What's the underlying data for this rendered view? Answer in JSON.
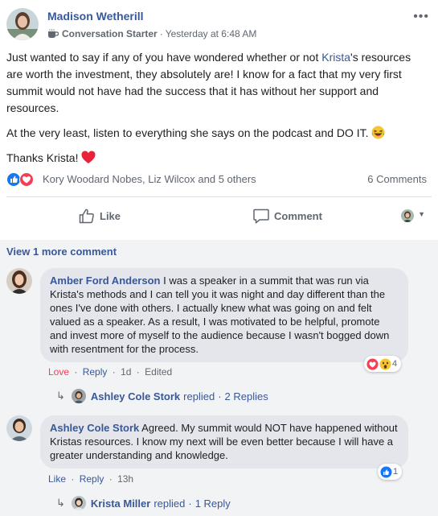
{
  "post": {
    "author": "Madison Wetherill",
    "badge": "Conversation Starter",
    "separator": "·",
    "timestamp": "Yesterday at 6:48 AM",
    "more_icon": "•••",
    "body_pre": "Just wanted to say if any of you have wondered whether or not ",
    "body_link": "Krista",
    "body_post": "'s resources are worth the investment, they absolutely are! I know for a fact that my very first summit would not have had the success that it has without her support and resources.",
    "body_p2": "At the very least, listen to everything she says on the podcast and DO IT.",
    "body_p3": "Thanks Krista!",
    "reactions_names": "Kory Woodard Nobes, Liz Wilcox and 5 others",
    "comment_count": "6 Comments",
    "like_label": "Like",
    "comment_label": "Comment",
    "caret": "▼"
  },
  "comments": {
    "view_more": "View 1 more comment",
    "items": [
      {
        "name": "Amber Ford Anderson",
        "text": "I was a speaker in a summit that was run via Krista's methods and I can tell you it was night and day different than the ones I've done with others. I actually knew what was going on and felt valued as a speaker. As a result, I was motivated to be helpful, promote and invest more of myself to the audience because I wasn't bogged down with resentment for the process.",
        "love": "Love",
        "reply": "Reply",
        "time": "1d",
        "edited": "Edited",
        "reaction_count": "4",
        "replied_name": "Ashley Cole Stork",
        "replied_label": "replied",
        "replies_count": "2 Replies"
      },
      {
        "name": "Ashley Cole Stork",
        "text": "Agreed. My summit would NOT have happened without Kristas resources. I know my next will be even better because I will have a greater understanding and knowledge.",
        "like": "Like",
        "reply": "Reply",
        "time": "13h",
        "reaction_count": "1",
        "replied_name": "Krista Miller",
        "replied_label": "replied",
        "replies_count": "1 Reply"
      }
    ],
    "dot": "·",
    "arrow": "↳"
  },
  "colors": {
    "link": "#385898",
    "muted": "#606770",
    "like_blue": "#1877f2",
    "love_red": "#f33e58",
    "bubble": "#e4e6eb",
    "comments_bg": "#f2f3f5"
  },
  "icons": {
    "badge": "coffee-cup-icon",
    "like": "thumbs-up-icon",
    "comment": "speech-bubble-icon",
    "heart": "red-heart-emoji",
    "laugh": "laughing-emoji"
  }
}
